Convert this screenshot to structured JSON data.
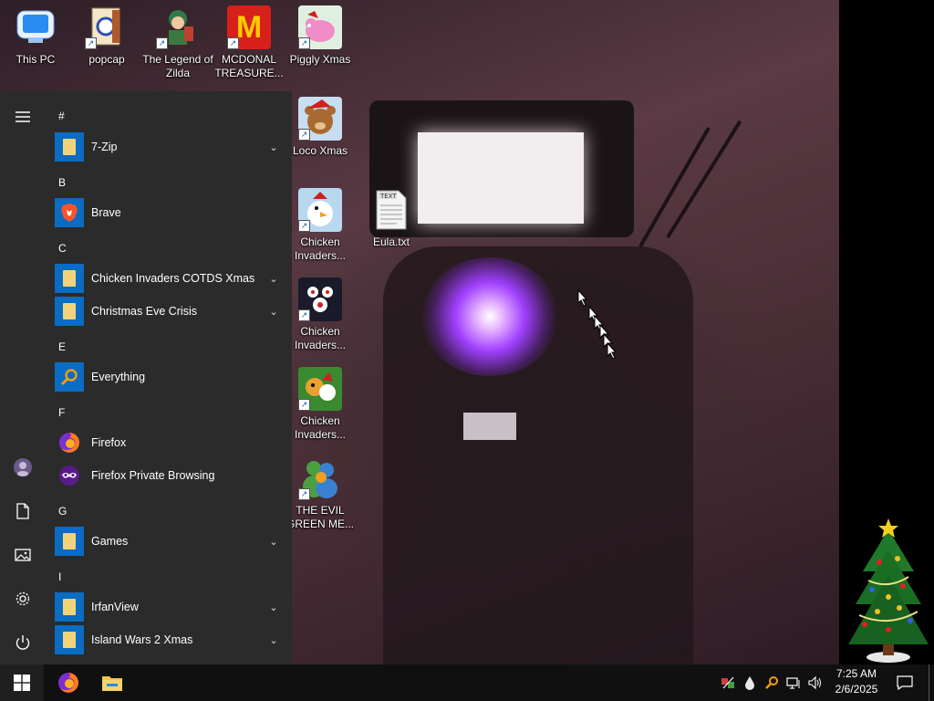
{
  "desktop_icons": [
    {
      "label": "This PC",
      "icon": "computer-icon"
    },
    {
      "label": "popcap",
      "icon": "popcap-icon"
    },
    {
      "label": "The Legend of Zilda",
      "icon": "zilda-game-icon"
    },
    {
      "label": "MCDONAL TREASURE...",
      "icon": "mcdonalds-icon"
    },
    {
      "label": "Piggly Xmas",
      "icon": "pig-icon"
    },
    {
      "label": "Loco Xmas",
      "icon": "teddy-bear-icon"
    },
    {
      "label": "Chicken Invaders...",
      "icon": "chicken-icon"
    },
    {
      "label": "Eula.txt",
      "icon": "text-file-icon"
    },
    {
      "label": "Chicken Invaders...",
      "icon": "chicken-icon"
    },
    {
      "label": "Chicken Invaders...",
      "icon": "chicken-icon"
    },
    {
      "label": "THE EVIL GREEN ME...",
      "icon": "messenger-icon"
    }
  ],
  "start_menu": {
    "sections": [
      {
        "letter": "#",
        "apps": [
          {
            "name": "7-Zip",
            "expandable": true
          }
        ]
      },
      {
        "letter": "B",
        "apps": [
          {
            "name": "Brave",
            "expandable": false
          }
        ]
      },
      {
        "letter": "C",
        "apps": [
          {
            "name": "Chicken Invaders COTDS Xmas",
            "expandable": true
          },
          {
            "name": "Christmas Eve Crisis",
            "expandable": true
          }
        ]
      },
      {
        "letter": "E",
        "apps": [
          {
            "name": "Everything",
            "expandable": false
          }
        ]
      },
      {
        "letter": "F",
        "apps": [
          {
            "name": "Firefox",
            "expandable": false
          },
          {
            "name": "Firefox Private Browsing",
            "expandable": false
          }
        ]
      },
      {
        "letter": "G",
        "apps": [
          {
            "name": "Games",
            "expandable": true
          }
        ]
      },
      {
        "letter": "I",
        "apps": [
          {
            "name": "IrfanView",
            "expandable": true
          },
          {
            "name": "Island Wars 2 Xmas",
            "expandable": true
          }
        ]
      }
    ],
    "rail_icons": [
      "hamburger-menu-icon",
      "user-avatar-icon",
      "documents-icon",
      "pictures-icon",
      "settings-gear-icon",
      "power-icon"
    ]
  },
  "taskbar": {
    "pinned": [
      "windows-start-icon",
      "firefox-icon",
      "file-explorer-icon"
    ],
    "tray_icons": [
      "network-manager-icon",
      "droplet-icon",
      "everything-search-icon",
      "network-icon",
      "volume-icon"
    ],
    "time": "7:25 AM",
    "date": "2/6/2025",
    "notification_icon": "action-center-icon"
  },
  "colors": {
    "start_menu_bg": "#2b2b2b",
    "tile_blue": "#0a6cc2",
    "taskbar_bg": "#101010",
    "folder_yellow": "#f3d37a"
  }
}
